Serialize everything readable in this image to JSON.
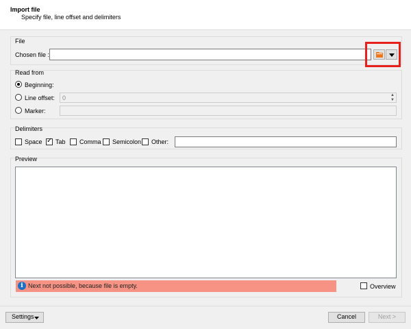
{
  "header": {
    "title": "Import file",
    "subtitle": "Specify file, line offset and delimiters"
  },
  "file_group": {
    "label": "File",
    "chosen_file_label": "Chosen file :",
    "chosen_file_value": ""
  },
  "read_from": {
    "label": "Read from",
    "options": [
      {
        "label": "Beginning:",
        "selected": true
      },
      {
        "label": "Line offset:",
        "selected": false
      },
      {
        "label": "Marker:",
        "selected": false
      }
    ],
    "line_offset_value": "0",
    "marker_value": ""
  },
  "delimiters": {
    "label": "Delimiters",
    "items": [
      {
        "label": "Space",
        "checked": false
      },
      {
        "label": "Tab",
        "checked": true
      },
      {
        "label": "Comma",
        "checked": false
      },
      {
        "label": "Semicolon",
        "checked": false
      },
      {
        "label": "Other:",
        "checked": false
      }
    ],
    "other_value": ""
  },
  "preview": {
    "label": "Preview",
    "message": "Next not possible, because file is empty.",
    "overview_label": "Overview",
    "overview_checked": false
  },
  "footer": {
    "settings_label": "Settings",
    "cancel_label": "Cancel",
    "next_label": "Next >"
  },
  "colors": {
    "highlight": "#e8201b",
    "message_bg": "#f69384",
    "info_icon": "#1e6fc3",
    "folder_icon": "#f0761c"
  }
}
